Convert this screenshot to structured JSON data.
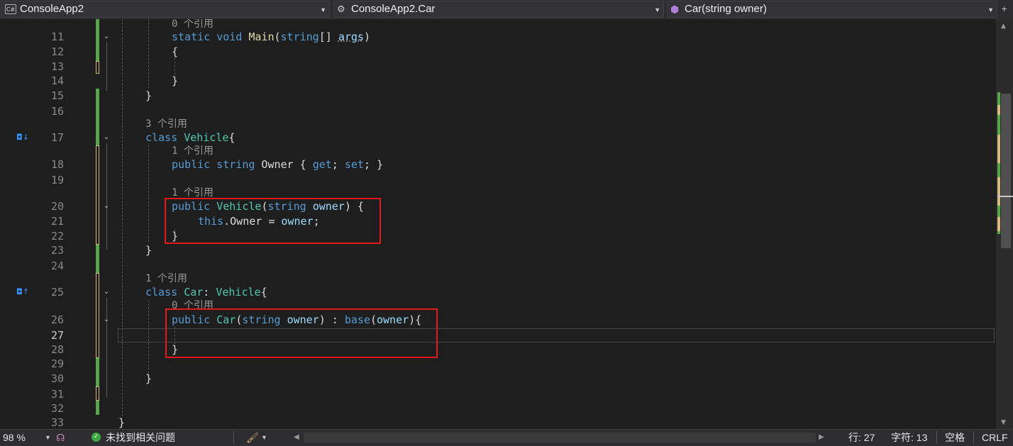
{
  "nav": {
    "project_icon": "C#",
    "project": "ConsoleApp2",
    "class_path": "ConsoleApp2.Car",
    "member": "Car(string owner)"
  },
  "code_lens": {
    "l10": "0 个引用",
    "l17": "3 个引用",
    "l18": "1 个引用",
    "l20": "1 个引用",
    "l25": "1 个引用",
    "l26": "0 个引用"
  },
  "line_numbers": [
    "11",
    "12",
    "13",
    "14",
    "15",
    "16",
    "17",
    "18",
    "19",
    "20",
    "21",
    "22",
    "23",
    "24",
    "25",
    "26",
    "27",
    "28",
    "29",
    "30",
    "31",
    "32",
    "33"
  ],
  "code": {
    "l11": [
      "static",
      " ",
      "void",
      " ",
      "Main",
      "(",
      "string",
      "[] ",
      "args",
      ")"
    ],
    "l12": "{",
    "l14": "}",
    "l15": "}",
    "l17": [
      "class",
      " ",
      "Vehicle",
      "{"
    ],
    "l18": [
      "public",
      " ",
      "string",
      " Owner { ",
      "get",
      "; ",
      "set",
      "; }"
    ],
    "l20": [
      "public",
      " ",
      "Vehicle",
      "(",
      "string",
      " ",
      "owner",
      ") {"
    ],
    "l21": [
      "this",
      ".Owner = ",
      "owner",
      ";"
    ],
    "l22": "}",
    "l23": "}",
    "l25": [
      "class",
      " ",
      "Car",
      ": ",
      "Vehicle",
      "{"
    ],
    "l26": [
      "public",
      " ",
      "Car",
      "(",
      "string",
      " ",
      "owner",
      ") : ",
      "base",
      "(",
      "owner",
      "){"
    ],
    "l28": "}",
    "l30": "}",
    "l33": "}"
  },
  "status": {
    "zoom": "98 %",
    "issues": "未找到相关问题",
    "line": "行: 27",
    "char": "字符: 13",
    "spaces": "空格",
    "eol": "CRLF"
  },
  "colors": {
    "keyword": "#569cd6",
    "type": "#4ec9b0",
    "method": "#dcdcaa",
    "parameter": "#9cdcfe",
    "highlight_box": "#e11b1b",
    "saved_change": "#57a64a",
    "unsaved_change": "#d7ba7d"
  }
}
